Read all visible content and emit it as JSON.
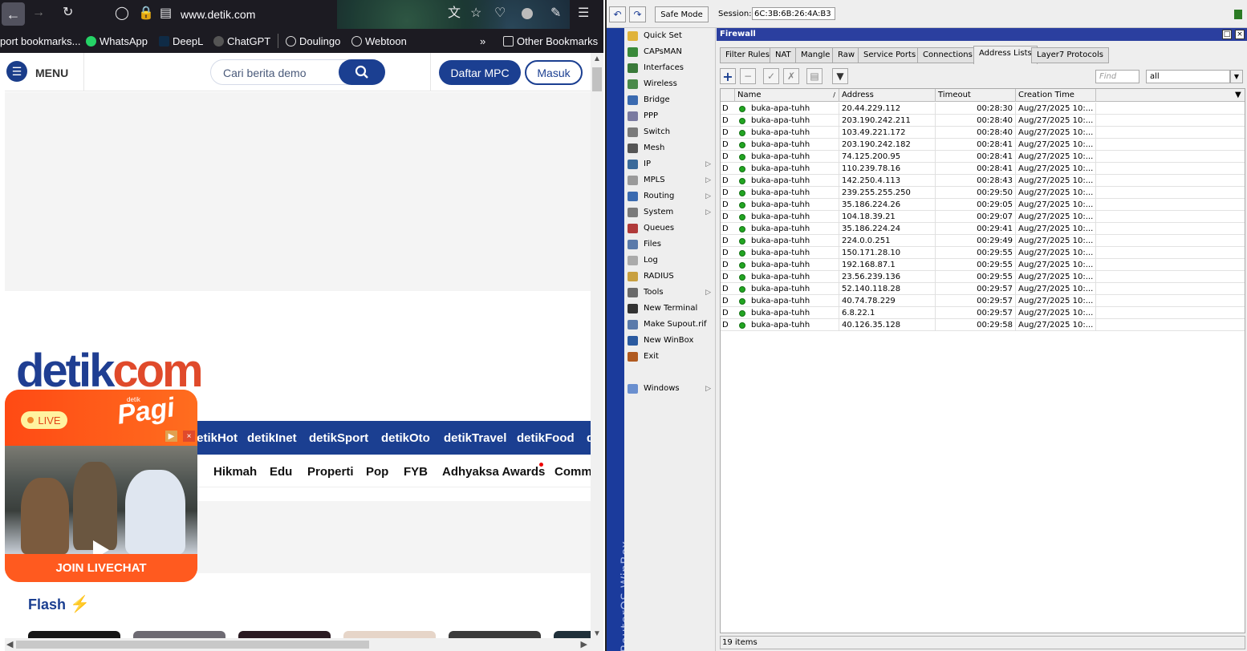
{
  "browser": {
    "url": "www.detik.com",
    "bookmarks": [
      "port bookmarks...",
      "WhatsApp",
      "DeepL",
      "ChatGPT",
      "Doulingo",
      "Webtoon",
      "Other Bookmarks"
    ]
  },
  "site": {
    "menu_label": "MENU",
    "search_placeholder": "Cari berita demo",
    "daftar_label": "Daftar MPC",
    "masuk_label": "Masuk",
    "logo_main": "detik",
    "logo_com": "com",
    "categories": [
      "detikHot",
      "detikInet",
      "detikSport",
      "detikOto",
      "detikTravel",
      "detikFood",
      "d"
    ],
    "subcategories": [
      "Hikmah",
      "Edu",
      "Properti",
      "Pop",
      "FYB",
      "Adhyaksa Awards",
      "Comm"
    ],
    "flash_label": "Flash",
    "live": {
      "badge": "LIVE",
      "brand_small": "detik",
      "brand": "Pagi",
      "join": "JOIN LIVECHAT"
    }
  },
  "winbox": {
    "safe_mode": "Safe Mode",
    "session_label": "Session:",
    "session_value": "6C:3B:6B:26:4A:B3",
    "vertical_brand": "RouterOS WinBox",
    "menu": [
      {
        "label": "Quick Set",
        "icon": "quick-set-icon",
        "arrow": false
      },
      {
        "label": "CAPsMAN",
        "icon": "capsman-icon",
        "arrow": false
      },
      {
        "label": "Interfaces",
        "icon": "interfaces-icon",
        "arrow": false
      },
      {
        "label": "Wireless",
        "icon": "wireless-icon",
        "arrow": false
      },
      {
        "label": "Bridge",
        "icon": "bridge-icon",
        "arrow": false
      },
      {
        "label": "PPP",
        "icon": "ppp-icon",
        "arrow": false
      },
      {
        "label": "Switch",
        "icon": "switch-icon",
        "arrow": false
      },
      {
        "label": "Mesh",
        "icon": "mesh-icon",
        "arrow": false
      },
      {
        "label": "IP",
        "icon": "ip-icon",
        "arrow": true
      },
      {
        "label": "MPLS",
        "icon": "mpls-icon",
        "arrow": true
      },
      {
        "label": "Routing",
        "icon": "routing-icon",
        "arrow": true
      },
      {
        "label": "System",
        "icon": "system-icon",
        "arrow": true
      },
      {
        "label": "Queues",
        "icon": "queues-icon",
        "arrow": false
      },
      {
        "label": "Files",
        "icon": "files-icon",
        "arrow": false
      },
      {
        "label": "Log",
        "icon": "log-icon",
        "arrow": false
      },
      {
        "label": "RADIUS",
        "icon": "radius-icon",
        "arrow": false
      },
      {
        "label": "Tools",
        "icon": "tools-icon",
        "arrow": true
      },
      {
        "label": "New Terminal",
        "icon": "terminal-icon",
        "arrow": false
      },
      {
        "label": "Make Supout.rif",
        "icon": "supout-icon",
        "arrow": false
      },
      {
        "label": "New WinBox",
        "icon": "winbox-icon",
        "arrow": false
      },
      {
        "label": "Exit",
        "icon": "exit-icon",
        "arrow": false
      }
    ],
    "windows_label": "Windows",
    "firewall": {
      "title": "Firewall",
      "tabs": [
        "Filter Rules",
        "NAT",
        "Mangle",
        "Raw",
        "Service Ports",
        "Connections",
        "Address Lists",
        "Layer7 Protocols"
      ],
      "active_tab": "Address Lists",
      "find_placeholder": "Find",
      "filter_value": "all",
      "columns": [
        "Name",
        "Address",
        "Timeout",
        "Creation Time"
      ],
      "rows": [
        {
          "flag": "D",
          "name": "buka-apa-tuhh",
          "address": "20.44.229.112",
          "timeout": "00:28:30",
          "created": "Aug/27/2025 10:..."
        },
        {
          "flag": "D",
          "name": "buka-apa-tuhh",
          "address": "203.190.242.211",
          "timeout": "00:28:40",
          "created": "Aug/27/2025 10:..."
        },
        {
          "flag": "D",
          "name": "buka-apa-tuhh",
          "address": "103.49.221.172",
          "timeout": "00:28:40",
          "created": "Aug/27/2025 10:..."
        },
        {
          "flag": "D",
          "name": "buka-apa-tuhh",
          "address": "203.190.242.182",
          "timeout": "00:28:41",
          "created": "Aug/27/2025 10:..."
        },
        {
          "flag": "D",
          "name": "buka-apa-tuhh",
          "address": "74.125.200.95",
          "timeout": "00:28:41",
          "created": "Aug/27/2025 10:..."
        },
        {
          "flag": "D",
          "name": "buka-apa-tuhh",
          "address": "110.239.78.16",
          "timeout": "00:28:41",
          "created": "Aug/27/2025 10:..."
        },
        {
          "flag": "D",
          "name": "buka-apa-tuhh",
          "address": "142.250.4.113",
          "timeout": "00:28:43",
          "created": "Aug/27/2025 10:..."
        },
        {
          "flag": "D",
          "name": "buka-apa-tuhh",
          "address": "239.255.255.250",
          "timeout": "00:29:50",
          "created": "Aug/27/2025 10:..."
        },
        {
          "flag": "D",
          "name": "buka-apa-tuhh",
          "address": "35.186.224.26",
          "timeout": "00:29:05",
          "created": "Aug/27/2025 10:..."
        },
        {
          "flag": "D",
          "name": "buka-apa-tuhh",
          "address": "104.18.39.21",
          "timeout": "00:29:07",
          "created": "Aug/27/2025 10:..."
        },
        {
          "flag": "D",
          "name": "buka-apa-tuhh",
          "address": "35.186.224.24",
          "timeout": "00:29:41",
          "created": "Aug/27/2025 10:..."
        },
        {
          "flag": "D",
          "name": "buka-apa-tuhh",
          "address": "224.0.0.251",
          "timeout": "00:29:49",
          "created": "Aug/27/2025 10:..."
        },
        {
          "flag": "D",
          "name": "buka-apa-tuhh",
          "address": "150.171.28.10",
          "timeout": "00:29:55",
          "created": "Aug/27/2025 10:..."
        },
        {
          "flag": "D",
          "name": "buka-apa-tuhh",
          "address": "192.168.87.1",
          "timeout": "00:29:55",
          "created": "Aug/27/2025 10:..."
        },
        {
          "flag": "D",
          "name": "buka-apa-tuhh",
          "address": "23.56.239.136",
          "timeout": "00:29:55",
          "created": "Aug/27/2025 10:..."
        },
        {
          "flag": "D",
          "name": "buka-apa-tuhh",
          "address": "52.140.118.28",
          "timeout": "00:29:57",
          "created": "Aug/27/2025 10:..."
        },
        {
          "flag": "D",
          "name": "buka-apa-tuhh",
          "address": "40.74.78.229",
          "timeout": "00:29:57",
          "created": "Aug/27/2025 10:..."
        },
        {
          "flag": "D",
          "name": "buka-apa-tuhh",
          "address": "6.8.22.1",
          "timeout": "00:29:57",
          "created": "Aug/27/2025 10:..."
        },
        {
          "flag": "D",
          "name": "buka-apa-tuhh",
          "address": "40.126.35.128",
          "timeout": "00:29:58",
          "created": "Aug/27/2025 10:..."
        }
      ],
      "status": "19 items"
    }
  }
}
